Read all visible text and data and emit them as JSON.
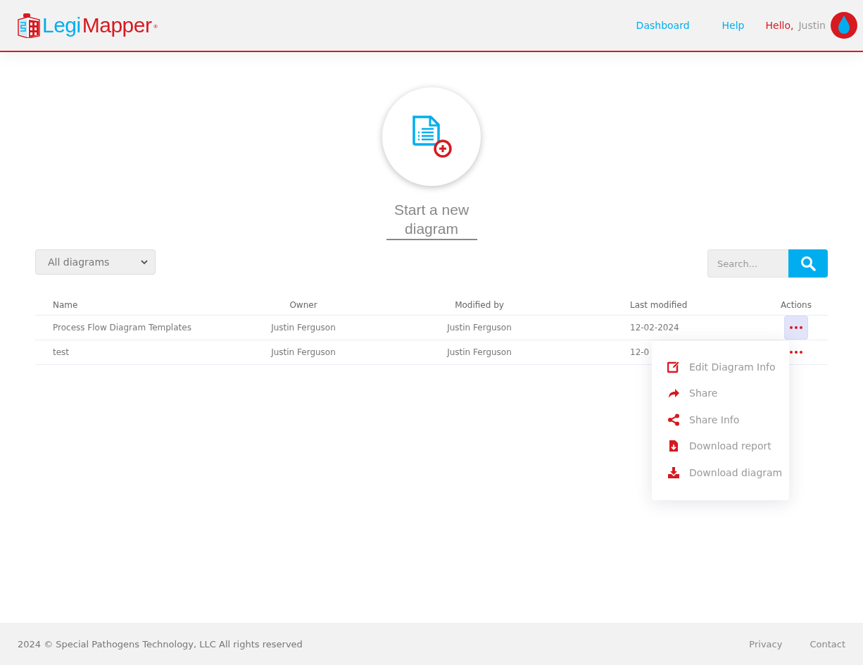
{
  "header": {
    "logo": {
      "part1": "Legi",
      "part2": "Mapper",
      "mark": "®"
    },
    "nav": [
      {
        "label": "Dashboard"
      },
      {
        "label": "Help"
      }
    ],
    "greeting": "Hello,",
    "user": "Justin"
  },
  "new_diagram": {
    "label": "Start a new diagram"
  },
  "filter": {
    "value": "All diagrams"
  },
  "search": {
    "placeholder": "Search..."
  },
  "table": {
    "columns": [
      "Name",
      "Owner",
      "Modified by",
      "Last modified",
      "Actions"
    ],
    "rows": [
      {
        "name": "Process Flow Diagram Templates",
        "owner": "Justin Ferguson",
        "modified_by": "Justin Ferguson",
        "last_modified": "12-02-2024",
        "menu_open": true
      },
      {
        "name": "test",
        "owner": "Justin Ferguson",
        "modified_by": "Justin Ferguson",
        "last_modified": "12-0",
        "menu_open": false
      }
    ]
  },
  "actions_menu": [
    {
      "kind": "edit",
      "label": "Edit Diagram Info"
    },
    {
      "kind": "share",
      "label": "Share"
    },
    {
      "kind": "share-info",
      "label": "Share Info"
    },
    {
      "kind": "report",
      "label": "Download report"
    },
    {
      "kind": "download",
      "label": "Download diagram"
    }
  ],
  "footer": {
    "copyright": "2024 © Special Pathogens Technology, LLC All rights reserved",
    "links": [
      {
        "label": "Privacy"
      },
      {
        "label": "Contact"
      }
    ]
  }
}
